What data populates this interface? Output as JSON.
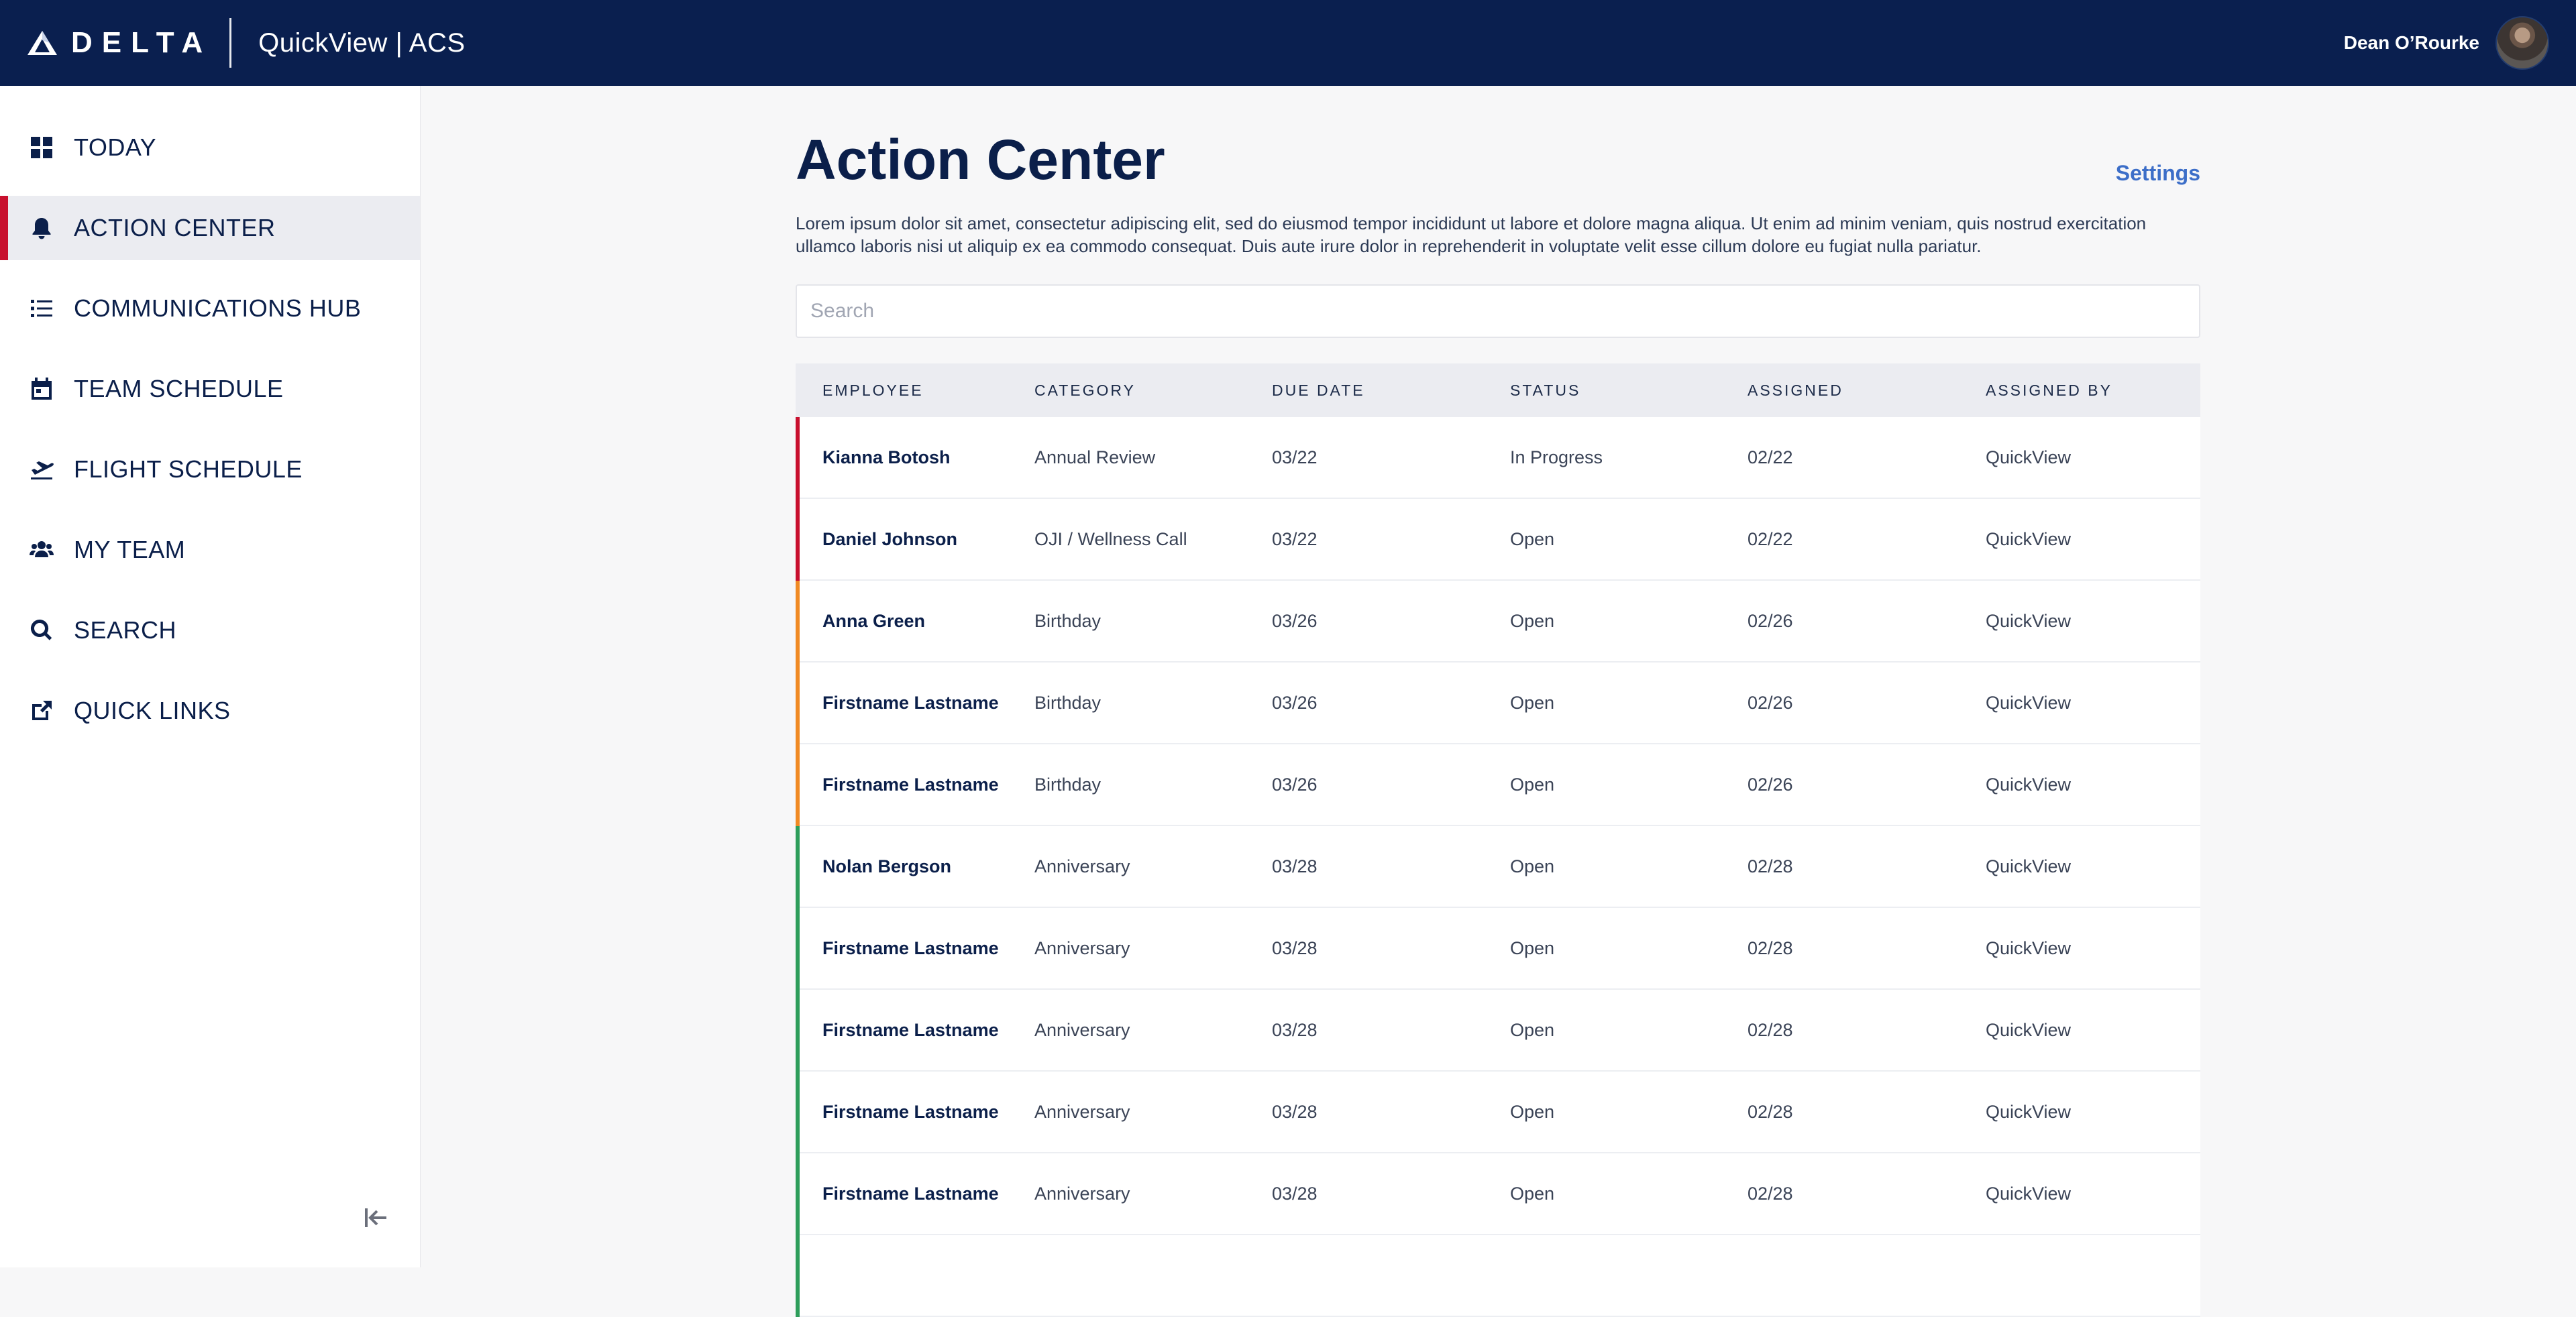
{
  "header": {
    "brand": "DELTA",
    "app_title": "QuickView | ACS",
    "user_name": "Dean O’Rourke"
  },
  "sidebar": {
    "items": [
      {
        "label": "TODAY",
        "icon": "dashboard-icon",
        "active": false
      },
      {
        "label": "ACTION CENTER",
        "icon": "bell-icon",
        "active": true
      },
      {
        "label": "COMMUNICATIONS HUB",
        "icon": "list-icon",
        "active": false
      },
      {
        "label": "TEAM SCHEDULE",
        "icon": "calendar-icon",
        "active": false
      },
      {
        "label": "FLIGHT SCHEDULE",
        "icon": "plane-departure-icon",
        "active": false
      },
      {
        "label": "MY TEAM",
        "icon": "users-icon",
        "active": false
      },
      {
        "label": "SEARCH",
        "icon": "search-icon",
        "active": false
      },
      {
        "label": "QUICK LINKS",
        "icon": "external-link-icon",
        "active": false
      }
    ],
    "collapse_icon": "collapse-left-icon"
  },
  "main": {
    "title": "Action Center",
    "settings_label": "Settings",
    "intro": "Lorem ipsum dolor sit amet, consectetur adipiscing elit, sed do eiusmod tempor incididunt ut labore et dolore magna aliqua. Ut enim ad minim veniam, quis nostrud exercitation ullamco laboris nisi ut aliquip ex ea commodo consequat. Duis aute irure dolor in reprehenderit in voluptate velit esse cillum dolore eu fugiat nulla pariatur.",
    "search": {
      "placeholder": "Search",
      "value": ""
    }
  },
  "table": {
    "columns": [
      "EMPLOYEE",
      "CATEGORY",
      "DUE DATE",
      "STATUS",
      "ASSIGNED",
      "ASSIGNED BY"
    ],
    "status_colors": {
      "red": "#c8102e",
      "orange": "#f08a24",
      "green": "#2e9e5b"
    },
    "rows": [
      {
        "employee": "Kianna Botosh",
        "category": "Annual Review",
        "due": "03/22",
        "status": "In Progress",
        "assigned": "02/22",
        "by": "QuickView",
        "color": "#c8102e"
      },
      {
        "employee": "Daniel Johnson",
        "category": "OJI / Wellness Call",
        "due": "03/22",
        "status": "Open",
        "assigned": "02/22",
        "by": "QuickView",
        "color": "#c8102e"
      },
      {
        "employee": "Anna Green",
        "category": "Birthday",
        "due": "03/26",
        "status": "Open",
        "assigned": "02/26",
        "by": "QuickView",
        "color": "#f08a24"
      },
      {
        "employee": "Firstname Lastname",
        "category": "Birthday",
        "due": "03/26",
        "status": "Open",
        "assigned": "02/26",
        "by": "QuickView",
        "color": "#f08a24"
      },
      {
        "employee": "Firstname Lastname",
        "category": "Birthday",
        "due": "03/26",
        "status": "Open",
        "assigned": "02/26",
        "by": "QuickView",
        "color": "#f08a24"
      },
      {
        "employee": "Nolan Bergson",
        "category": "Anniversary",
        "due": "03/28",
        "status": "Open",
        "assigned": "02/28",
        "by": "QuickView",
        "color": "#2e9e5b"
      },
      {
        "employee": "Firstname Lastname",
        "category": "Anniversary",
        "due": "03/28",
        "status": "Open",
        "assigned": "02/28",
        "by": "QuickView",
        "color": "#2e9e5b"
      },
      {
        "employee": "Firstname Lastname",
        "category": "Anniversary",
        "due": "03/28",
        "status": "Open",
        "assigned": "02/28",
        "by": "QuickView",
        "color": "#2e9e5b"
      },
      {
        "employee": "Firstname Lastname",
        "category": "Anniversary",
        "due": "03/28",
        "status": "Open",
        "assigned": "02/28",
        "by": "QuickView",
        "color": "#2e9e5b"
      },
      {
        "employee": "Firstname Lastname",
        "category": "Anniversary",
        "due": "03/28",
        "status": "Open",
        "assigned": "02/28",
        "by": "QuickView",
        "color": "#2e9e5b"
      },
      {
        "employee": "",
        "category": "",
        "due": "",
        "status": "",
        "assigned": "",
        "by": "",
        "color": "#2e9e5b"
      }
    ]
  }
}
